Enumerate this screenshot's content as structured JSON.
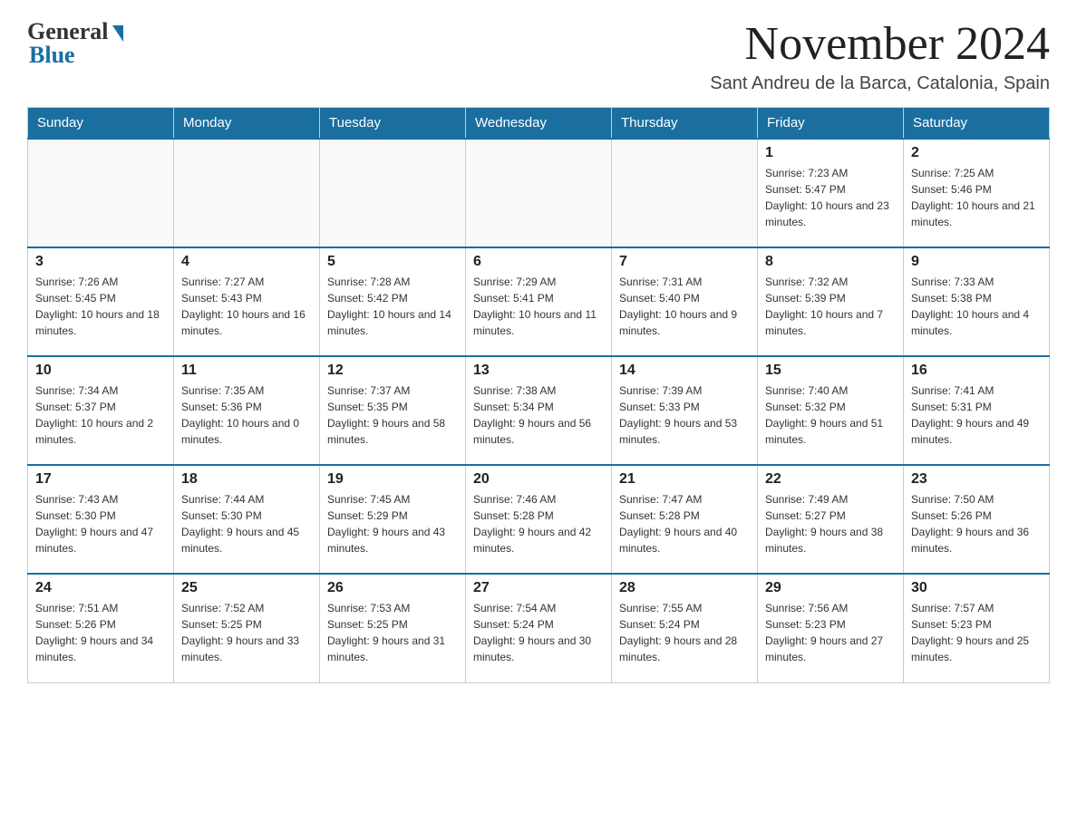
{
  "logo": {
    "general": "General",
    "blue": "Blue"
  },
  "title": {
    "month_year": "November 2024",
    "location": "Sant Andreu de la Barca, Catalonia, Spain"
  },
  "weekdays": [
    "Sunday",
    "Monday",
    "Tuesday",
    "Wednesday",
    "Thursday",
    "Friday",
    "Saturday"
  ],
  "weeks": [
    [
      {
        "day": "",
        "info": ""
      },
      {
        "day": "",
        "info": ""
      },
      {
        "day": "",
        "info": ""
      },
      {
        "day": "",
        "info": ""
      },
      {
        "day": "",
        "info": ""
      },
      {
        "day": "1",
        "info": "Sunrise: 7:23 AM\nSunset: 5:47 PM\nDaylight: 10 hours and 23 minutes."
      },
      {
        "day": "2",
        "info": "Sunrise: 7:25 AM\nSunset: 5:46 PM\nDaylight: 10 hours and 21 minutes."
      }
    ],
    [
      {
        "day": "3",
        "info": "Sunrise: 7:26 AM\nSunset: 5:45 PM\nDaylight: 10 hours and 18 minutes."
      },
      {
        "day": "4",
        "info": "Sunrise: 7:27 AM\nSunset: 5:43 PM\nDaylight: 10 hours and 16 minutes."
      },
      {
        "day": "5",
        "info": "Sunrise: 7:28 AM\nSunset: 5:42 PM\nDaylight: 10 hours and 14 minutes."
      },
      {
        "day": "6",
        "info": "Sunrise: 7:29 AM\nSunset: 5:41 PM\nDaylight: 10 hours and 11 minutes."
      },
      {
        "day": "7",
        "info": "Sunrise: 7:31 AM\nSunset: 5:40 PM\nDaylight: 10 hours and 9 minutes."
      },
      {
        "day": "8",
        "info": "Sunrise: 7:32 AM\nSunset: 5:39 PM\nDaylight: 10 hours and 7 minutes."
      },
      {
        "day": "9",
        "info": "Sunrise: 7:33 AM\nSunset: 5:38 PM\nDaylight: 10 hours and 4 minutes."
      }
    ],
    [
      {
        "day": "10",
        "info": "Sunrise: 7:34 AM\nSunset: 5:37 PM\nDaylight: 10 hours and 2 minutes."
      },
      {
        "day": "11",
        "info": "Sunrise: 7:35 AM\nSunset: 5:36 PM\nDaylight: 10 hours and 0 minutes."
      },
      {
        "day": "12",
        "info": "Sunrise: 7:37 AM\nSunset: 5:35 PM\nDaylight: 9 hours and 58 minutes."
      },
      {
        "day": "13",
        "info": "Sunrise: 7:38 AM\nSunset: 5:34 PM\nDaylight: 9 hours and 56 minutes."
      },
      {
        "day": "14",
        "info": "Sunrise: 7:39 AM\nSunset: 5:33 PM\nDaylight: 9 hours and 53 minutes."
      },
      {
        "day": "15",
        "info": "Sunrise: 7:40 AM\nSunset: 5:32 PM\nDaylight: 9 hours and 51 minutes."
      },
      {
        "day": "16",
        "info": "Sunrise: 7:41 AM\nSunset: 5:31 PM\nDaylight: 9 hours and 49 minutes."
      }
    ],
    [
      {
        "day": "17",
        "info": "Sunrise: 7:43 AM\nSunset: 5:30 PM\nDaylight: 9 hours and 47 minutes."
      },
      {
        "day": "18",
        "info": "Sunrise: 7:44 AM\nSunset: 5:30 PM\nDaylight: 9 hours and 45 minutes."
      },
      {
        "day": "19",
        "info": "Sunrise: 7:45 AM\nSunset: 5:29 PM\nDaylight: 9 hours and 43 minutes."
      },
      {
        "day": "20",
        "info": "Sunrise: 7:46 AM\nSunset: 5:28 PM\nDaylight: 9 hours and 42 minutes."
      },
      {
        "day": "21",
        "info": "Sunrise: 7:47 AM\nSunset: 5:28 PM\nDaylight: 9 hours and 40 minutes."
      },
      {
        "day": "22",
        "info": "Sunrise: 7:49 AM\nSunset: 5:27 PM\nDaylight: 9 hours and 38 minutes."
      },
      {
        "day": "23",
        "info": "Sunrise: 7:50 AM\nSunset: 5:26 PM\nDaylight: 9 hours and 36 minutes."
      }
    ],
    [
      {
        "day": "24",
        "info": "Sunrise: 7:51 AM\nSunset: 5:26 PM\nDaylight: 9 hours and 34 minutes."
      },
      {
        "day": "25",
        "info": "Sunrise: 7:52 AM\nSunset: 5:25 PM\nDaylight: 9 hours and 33 minutes."
      },
      {
        "day": "26",
        "info": "Sunrise: 7:53 AM\nSunset: 5:25 PM\nDaylight: 9 hours and 31 minutes."
      },
      {
        "day": "27",
        "info": "Sunrise: 7:54 AM\nSunset: 5:24 PM\nDaylight: 9 hours and 30 minutes."
      },
      {
        "day": "28",
        "info": "Sunrise: 7:55 AM\nSunset: 5:24 PM\nDaylight: 9 hours and 28 minutes."
      },
      {
        "day": "29",
        "info": "Sunrise: 7:56 AM\nSunset: 5:23 PM\nDaylight: 9 hours and 27 minutes."
      },
      {
        "day": "30",
        "info": "Sunrise: 7:57 AM\nSunset: 5:23 PM\nDaylight: 9 hours and 25 minutes."
      }
    ]
  ]
}
